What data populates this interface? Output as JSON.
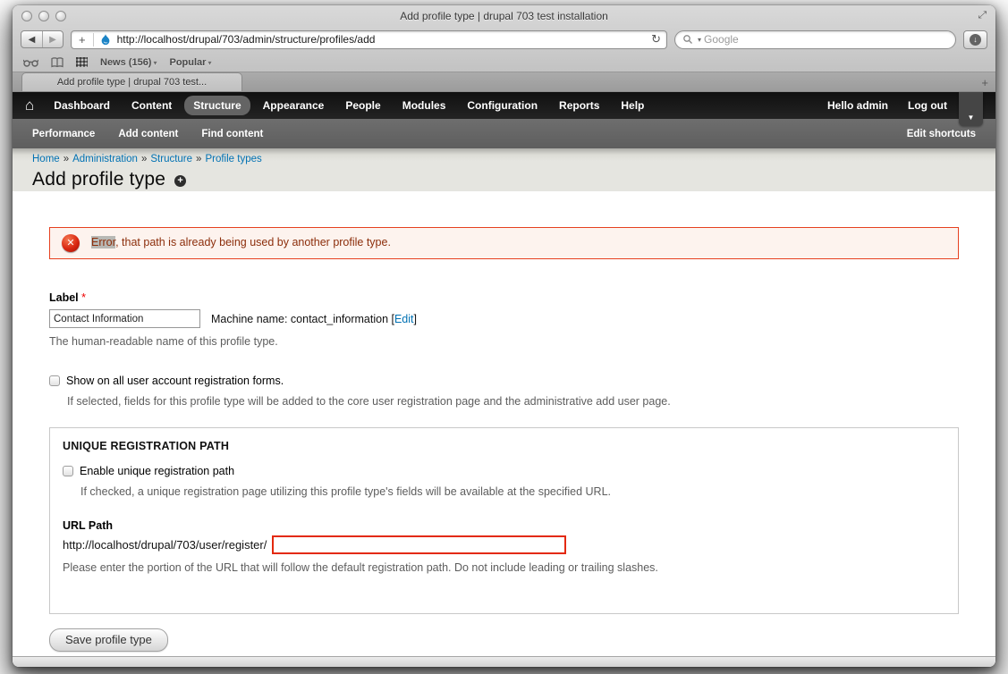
{
  "browser": {
    "window_title": "Add profile type | drupal 703 test installation",
    "url": "http://localhost/drupal/703/admin/structure/profiles/add",
    "search_placeholder": "Google",
    "bookmarks": [
      "News (156)",
      "Popular"
    ],
    "tab_title": "Add profile type | drupal 703 test..."
  },
  "icons": {
    "back": "◀",
    "forward": "▶",
    "add": "+",
    "reload": "↻",
    "download": "↓",
    "caret": "▾",
    "dropdown": "▼",
    "home": "⌂",
    "fullscreen": "⤢",
    "error_x": "✕",
    "title_plus": "+",
    "tab_plus": "+",
    "breadcrumb_sep": "»"
  },
  "toolbar": {
    "items": [
      "Dashboard",
      "Content",
      "Structure",
      "Appearance",
      "People",
      "Modules",
      "Configuration",
      "Reports",
      "Help"
    ],
    "active_item": "Structure",
    "greeting": "Hello admin",
    "logout": "Log out"
  },
  "shortcuts": {
    "items": [
      "Performance",
      "Add content",
      "Find content"
    ],
    "edit": "Edit shortcuts"
  },
  "breadcrumb": {
    "items": [
      "Home",
      "Administration",
      "Structure",
      "Profile types"
    ]
  },
  "page": {
    "title": "Add profile type",
    "error": {
      "highlighted_word": "Error",
      "rest": ", that path is already being used by another profile type."
    },
    "label_field": {
      "label": "Label",
      "required_marker": "*",
      "value": "Contact Information",
      "machine_name_text": "Machine name: contact_information [",
      "machine_edit_link": "Edit",
      "machine_close_bracket": "]",
      "description": "The human-readable name of this profile type."
    },
    "registration_checkbox": {
      "label": "Show on all user account registration forms.",
      "description": "If selected, fields for this profile type will be added to the core user registration page and the administrative add user page."
    },
    "fieldset": {
      "legend": "UNIQUE REGISTRATION PATH",
      "checkbox_label": "Enable unique registration path",
      "checkbox_description": "If checked, a unique registration page utilizing this profile type's fields will be available at the specified URL.",
      "url_label": "URL Path",
      "url_prefix": "http://localhost/drupal/703/user/register/",
      "url_value": "",
      "url_description": "Please enter the portion of the URL that will follow the default registration path. Do not include leading or trailing slashes."
    },
    "save_button": "Save profile type"
  },
  "colors": {
    "link_blue": "#0071b3",
    "error_border": "#e6401f",
    "error_background": "#fdf3ee",
    "error_text": "#8c2e0b",
    "toolbar_black": "#181818",
    "shortcut_gray": "#666666",
    "header_gray": "#e5e5e0",
    "required_red": "#ee0000",
    "url_input_error_border": "#e3290e"
  }
}
